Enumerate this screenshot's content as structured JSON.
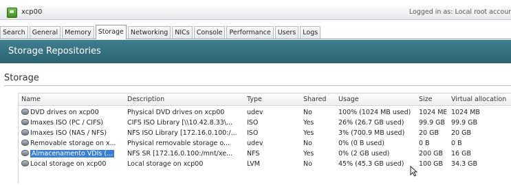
{
  "header": {
    "host": "xcp00",
    "login_text": "Logged in as: Local root account"
  },
  "tabs": [
    "Search",
    "General",
    "Memory",
    "Storage",
    "Networking",
    "NICs",
    "Console",
    "Performance",
    "Users",
    "Logs"
  ],
  "active_tab": "Storage",
  "banner": {
    "title": "Storage Repositories"
  },
  "section": {
    "title": "Storage"
  },
  "table": {
    "columns": [
      "Name",
      "Description",
      "Type",
      "Shared",
      "Usage",
      "Size",
      "Virtual allocation"
    ],
    "rows": [
      [
        "DVD drives on xcp00",
        "Physical DVD drives on xcp00",
        "udev",
        "No",
        "100% (1024 MB used)",
        "1024 MB",
        "1024 MB"
      ],
      [
        "Imaxes ISO (PC / CIFS)",
        "CIFS ISO Library [\\\\10.42.8.33\\...",
        "ISO",
        "Yes",
        "26% (26.7 GB used)",
        "99.9 GB",
        "99.9 GB"
      ],
      [
        "Imaxes ISO (NAS / NFS)",
        "NFS ISO Library [172.16.0.100:/...",
        "ISO",
        "Yes",
        "3% (700.9 MB used)",
        "20 GB",
        "20 GB"
      ],
      [
        "Removable storage on x...",
        "Physical removable storage o...",
        "udev",
        "No",
        "0% (0 B used)",
        "0 B",
        "0 B"
      ],
      [
        "Almacenamento VDIs (...",
        "NFS SR [172.16.0.100:/mnt/xe...",
        "NFS",
        "Yes",
        "0% (2 GB used)",
        "200 GB",
        "16 GB"
      ],
      [
        "Local storage on xcp00",
        "Local storage on xcp00",
        "LVM",
        "No",
        "45% (45.3 GB used)",
        "100 GB",
        "34.3 GB"
      ]
    ],
    "selected_row": 4
  },
  "colors": {
    "banner": "#2f6a7a",
    "selection": "#3a7fd6"
  }
}
